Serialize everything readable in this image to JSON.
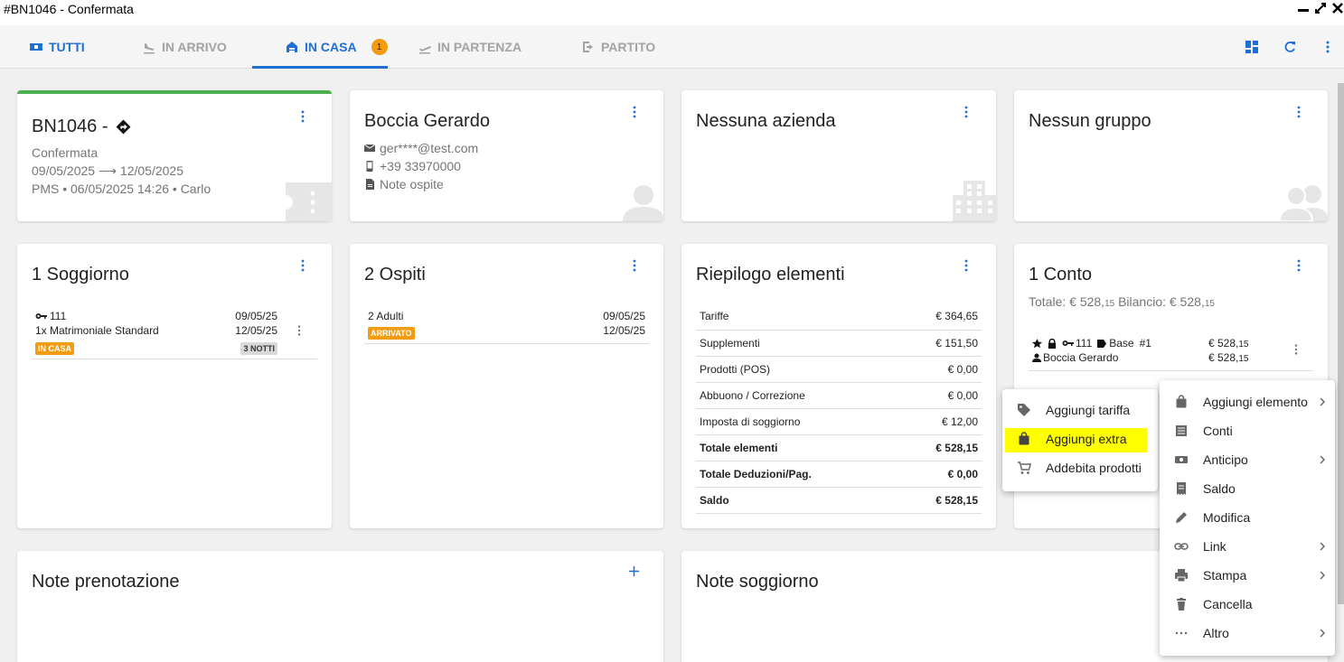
{
  "window": {
    "title": "#BN1046 - Confermata"
  },
  "tabs": [
    {
      "label": "TUTTI",
      "icon": "ticket-icon"
    },
    {
      "label": "IN ARRIVO",
      "icon": "plane-landing-icon"
    },
    {
      "label": "IN CASA",
      "icon": "home-icon",
      "badge": "1"
    },
    {
      "label": "IN PARTENZA",
      "icon": "plane-takeoff-icon"
    },
    {
      "label": "PARTITO",
      "icon": "exit-icon"
    }
  ],
  "booking": {
    "title": "BN1046 -",
    "status": "Confermata",
    "dates": "09/05/2025 ⟶ 12/05/2025",
    "source": "PMS • 06/05/2025 14:26 • Carlo"
  },
  "guest": {
    "name": "Boccia Gerardo",
    "email": "ger****@test.com",
    "phone": "+39 33970000",
    "notes": "Note ospite"
  },
  "company": {
    "title": "Nessuna azienda"
  },
  "group": {
    "title": "Nessun gruppo"
  },
  "stay": {
    "title": "1 Soggiorno",
    "room": "111",
    "room_type": "1x Matrimoniale Standard",
    "status_tag": "IN CASA",
    "arrival": "09/05/25",
    "departure": "12/05/25",
    "nights": "3 NOTTI"
  },
  "guests": {
    "title": "2 Ospiti",
    "count": "2 Adulti",
    "status_tag": "ARRIVATO",
    "arrival": "09/05/25",
    "departure": "12/05/25"
  },
  "summary": {
    "title": "Riepilogo elementi",
    "rows": [
      {
        "label": "Tariffe",
        "value": "€ 364,65",
        "bold": false
      },
      {
        "label": "Supplementi",
        "value": "€ 151,50",
        "bold": false
      },
      {
        "label": "Prodotti (POS)",
        "value": "€ 0,00",
        "bold": false
      },
      {
        "label": "Abbuono / Correzione",
        "value": "€ 0,00",
        "bold": false
      },
      {
        "label": "Imposta di soggiorno",
        "value": "€ 12,00",
        "bold": false
      },
      {
        "label": "Totale elementi",
        "value": "€ 528,15",
        "bold": true
      },
      {
        "label": "Totale Deduzioni/Pag.",
        "value": "€ 0,00",
        "bold": true
      },
      {
        "label": "Saldo",
        "value": "€ 528,15",
        "bold": true
      }
    ]
  },
  "account": {
    "title": "1 Conto",
    "totals_prefix": "Totale: € 528,",
    "totals_cents": "15",
    "balance_prefix": " Bilancio: € 528,",
    "balance_cents": "15",
    "room": "111",
    "rate_label": "Base",
    "account_no": "#1",
    "guest": "Boccia Gerardo",
    "amount1_main": "€ 528,",
    "amount1_cents": "15",
    "amount2_main": "€ 528,",
    "amount2_cents": "15"
  },
  "booking_notes": {
    "title": "Note prenotazione"
  },
  "stay_notes": {
    "title": "Note soggiorno"
  },
  "context_menu": {
    "items": [
      {
        "label": "Aggiungi elemento",
        "icon": "bag-icon",
        "submenu": true
      },
      {
        "label": "Conti",
        "icon": "list-icon",
        "submenu": false
      },
      {
        "label": "Anticipo",
        "icon": "money-icon",
        "submenu": true
      },
      {
        "label": "Saldo",
        "icon": "receipt-icon",
        "submenu": false
      },
      {
        "label": "Modifica",
        "icon": "pencil-icon",
        "submenu": false
      },
      {
        "label": "Link",
        "icon": "link-icon",
        "submenu": true
      },
      {
        "label": "Stampa",
        "icon": "printer-icon",
        "submenu": true
      },
      {
        "label": "Cancella",
        "icon": "trash-icon",
        "submenu": false
      },
      {
        "label": "Altro",
        "icon": "dots-icon",
        "submenu": true
      }
    ]
  },
  "submenu": {
    "items": [
      {
        "label": "Aggiungi tariffa",
        "icon": "tag-icon"
      },
      {
        "label": "Aggiungi extra",
        "icon": "bag-icon",
        "highlighted": true
      },
      {
        "label": "Addebita prodotti",
        "icon": "cart-icon"
      }
    ]
  },
  "colors": {
    "accent": "#1e6fd0",
    "booking_top_bar": "#4caf50",
    "badge": "#f39c12",
    "tag_in_casa": "#f39c12",
    "tag_arrivato": "#f39c12",
    "highlight": "#ffff00"
  }
}
